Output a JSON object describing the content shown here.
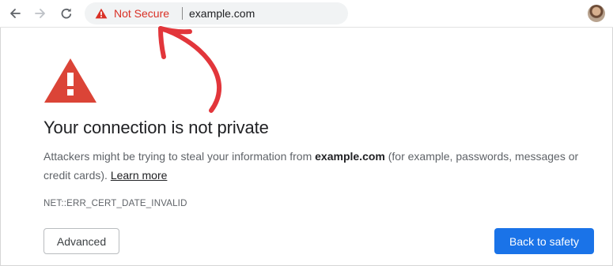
{
  "toolbar": {
    "back_icon": "arrow-left-icon",
    "forward_icon": "arrow-right-icon",
    "reload_icon": "reload-icon",
    "security_label": "Not Secure",
    "url": "example.com",
    "avatar": "profile-avatar"
  },
  "annotation": {
    "arrow_color": "#e2363b"
  },
  "interstitial": {
    "icon": "warning-triangle-icon",
    "title": "Your connection is not private",
    "description_prefix": "Attackers might be trying to steal your information from ",
    "description_domain": "example.com",
    "description_suffix": " (for example, passwords, messages or credit cards). ",
    "learn_more": "Learn more",
    "error_code": "NET::ERR_CERT_DATE_INVALID",
    "advanced_button": "Advanced",
    "safety_button": "Back to safety"
  },
  "colors": {
    "warning_red": "#d93025",
    "primary_blue": "#1a73e8"
  }
}
